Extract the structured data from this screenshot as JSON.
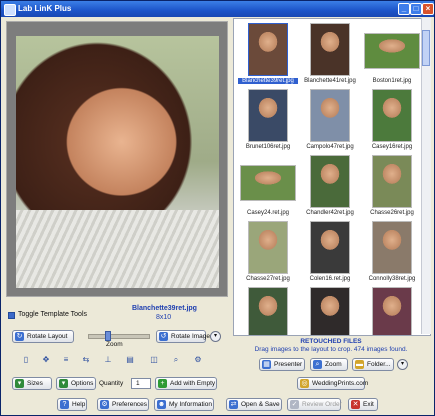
{
  "window": {
    "title": "Lab LinK Plus"
  },
  "photo": {
    "name": "Blanchette39ret.jpg",
    "size": "8x10"
  },
  "controls": {
    "toggle_label": "Toggle Template Tools",
    "rotate_layout": "Rotate Layout",
    "zoom_label": "Zoom",
    "zoom_level": 0.3,
    "rotate_image": "Rotate Image",
    "sizes": "Sizes",
    "options": "Options",
    "quantity_label": "Quantity",
    "quantity_value": "1",
    "add_with_empty": "Add with Empty"
  },
  "thumbnails": [
    {
      "caption": "Blanchette39ret.jpg",
      "selected": true,
      "wide": false,
      "color": "#6b4a3a"
    },
    {
      "caption": "Blanchette41ret.jpg",
      "selected": false,
      "wide": false,
      "color": "#4a3328"
    },
    {
      "caption": "Boston1ret.jpg",
      "selected": false,
      "wide": true,
      "color": "#5f8c3f"
    },
    {
      "caption": "Brunet106ret.jpg",
      "selected": false,
      "wide": false,
      "color": "#3a4a66"
    },
    {
      "caption": "Campolo47ret.jpg",
      "selected": false,
      "wide": false,
      "color": "#7f8fa8"
    },
    {
      "caption": "Casey16ret.jpg",
      "selected": false,
      "wide": false,
      "color": "#4c7a3c"
    },
    {
      "caption": "Casey24.ret.jpg",
      "selected": false,
      "wide": true,
      "color": "#6a8f4a"
    },
    {
      "caption": "Chandler42ret.jpg",
      "selected": false,
      "wide": false,
      "color": "#4a6a3a"
    },
    {
      "caption": "Chasse26ret.jpg",
      "selected": false,
      "wide": false,
      "color": "#7a8a58"
    },
    {
      "caption": "Chasse27ret.jpg",
      "selected": false,
      "wide": false,
      "color": "#9aa67a"
    },
    {
      "caption": "Colen16.ret.jpg",
      "selected": false,
      "wide": false,
      "color": "#3a3a3a"
    },
    {
      "caption": "Connolly38ret.jpg",
      "selected": false,
      "wide": false,
      "color": "#8a7a6a"
    },
    {
      "caption": "",
      "selected": false,
      "wide": false,
      "color": "#3f5a3a"
    },
    {
      "caption": "",
      "selected": false,
      "wide": false,
      "color": "#2f2a2a"
    },
    {
      "caption": "",
      "selected": false,
      "wide": false,
      "color": "#6a3a4a"
    }
  ],
  "retouched": {
    "title": "RETOUCHED FILES",
    "description": "Drag images to the layout to crop. 474 images found."
  },
  "right_buttons": {
    "presenter": "Presenter",
    "zoom": "Zoom",
    "folder": "Folder...",
    "website": "WeddingPrints.com"
  },
  "bottom": {
    "help": "Help",
    "preferences": "Preferences",
    "my_information": "My Information",
    "open_save": "Open & Save",
    "review_order": "Review Order",
    "exit": "Exit"
  },
  "colors": {
    "title_bar": "#1c54c9",
    "accent_text": "#1f3fb0",
    "selection": "#2f5fcf"
  }
}
